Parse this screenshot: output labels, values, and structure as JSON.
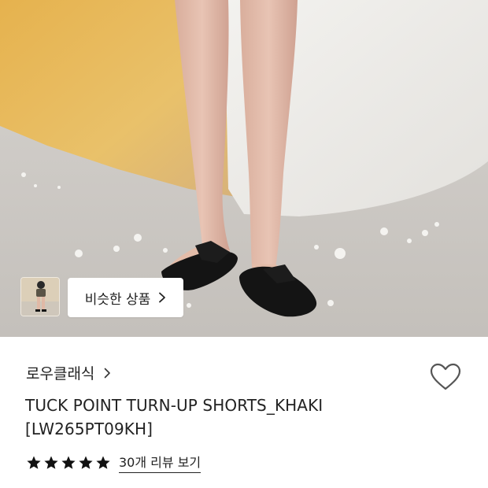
{
  "similar_button": {
    "label": "비슷한 상품",
    "icon": "chevron-right-icon"
  },
  "product": {
    "brand": "로우클래식",
    "brand_icon": "chevron-right-icon",
    "name_line1": "TUCK POINT TURN-UP SHORTS_KHAKI",
    "name_line2": "[LW265PT09KH]",
    "wishlist_icon": "heart-outline-icon",
    "rating": {
      "stars": 5,
      "max": 5,
      "review_link": "30개 리뷰 보기"
    }
  },
  "colors": {
    "text": "#222222",
    "star": "#111111",
    "background": "#ffffff"
  }
}
